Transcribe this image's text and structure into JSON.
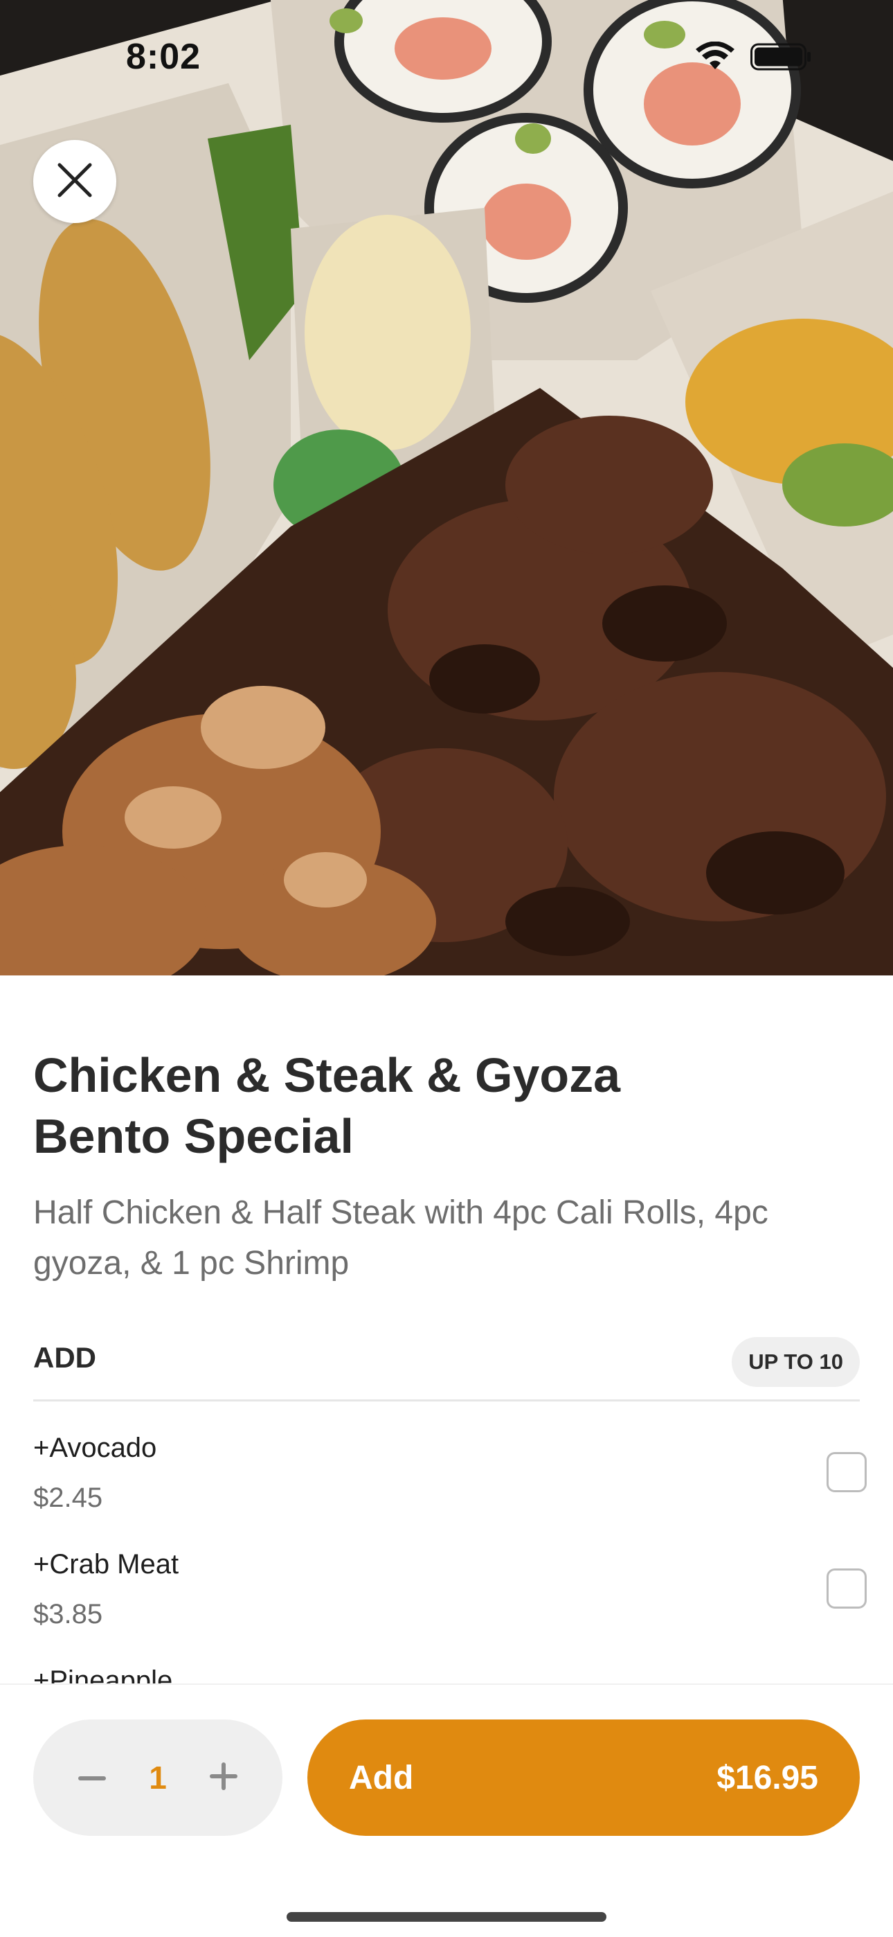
{
  "status_bar": {
    "time": "8:02",
    "icons": [
      "wifi-icon",
      "battery-icon"
    ]
  },
  "header": {
    "close_icon": "close-icon"
  },
  "item": {
    "title": "Chicken & Steak & Gyoza Bento Special",
    "description": "Half Chicken & Half Steak with 4pc Cali Rolls, 4pc gyoza, & 1 pc Shrimp"
  },
  "add_section": {
    "label": "ADD",
    "limit_badge": "UP TO 10",
    "options": [
      {
        "name": "+Avocado",
        "price": "$2.45",
        "checked": false
      },
      {
        "name": "+Crab Meat",
        "price": "$3.85",
        "checked": false
      },
      {
        "name": "+Pineapple",
        "price": "",
        "checked": false
      }
    ]
  },
  "footer": {
    "quantity": "1",
    "minus_icon": "minus-icon",
    "plus_icon": "plus-icon",
    "add_label": "Add",
    "total_price": "$16.95"
  },
  "colors": {
    "accent": "#e08a10",
    "text_primary": "#2b2b2b",
    "text_secondary": "#6d6d6d"
  }
}
